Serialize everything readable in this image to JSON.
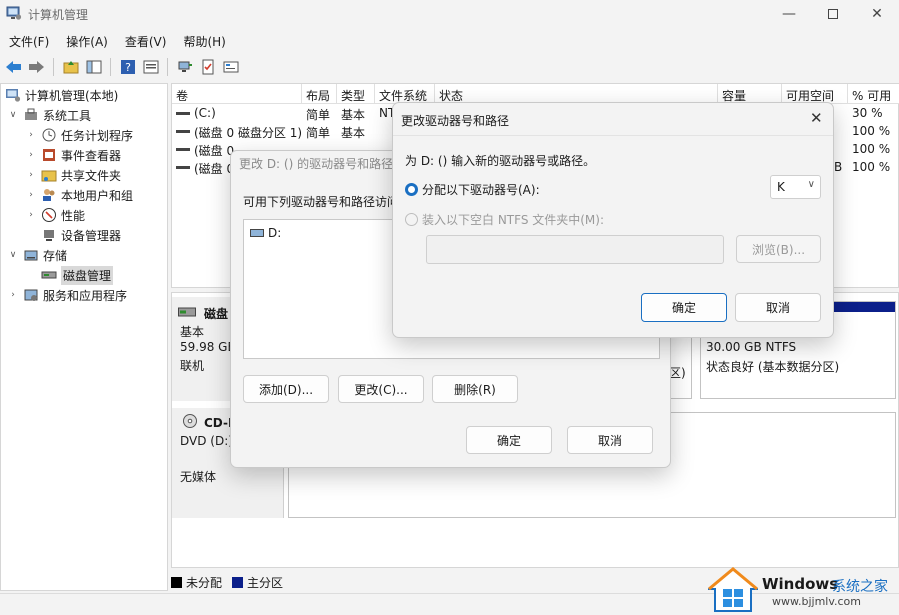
{
  "window": {
    "title": "计算机管理"
  },
  "menu": [
    "文件(F)",
    "操作(A)",
    "查看(V)",
    "帮助(H)"
  ],
  "toolbar": [
    "back-icon",
    "forward-icon",
    "up-folder-icon",
    "show-hide-tree-icon",
    "help-icon",
    "properties-icon",
    "connect-icon",
    "checklist-icon",
    "console-icon"
  ],
  "tree": {
    "root": "计算机管理(本地)",
    "system_tools": "系统工具",
    "task_scheduler": "任务计划程序",
    "event_viewer": "事件查看器",
    "shared_folders": "共享文件夹",
    "local_users": "本地用户和组",
    "performance": "性能",
    "device_manager": "设备管理器",
    "storage": "存储",
    "disk_management": "磁盘管理",
    "services": "服务和应用程序"
  },
  "list": {
    "headers": [
      "卷",
      "布局",
      "类型",
      "文件系统",
      "状态",
      "容量",
      "可用空间",
      "% 可用"
    ],
    "rows": [
      {
        "volume": "(C:)",
        "layout": "简单",
        "type": "基本",
        "fs": "NT",
        "free": "",
        "pct": "30 %"
      },
      {
        "volume": "(磁盘 0 磁盘分区 1)",
        "layout": "简单",
        "type": "基本",
        "fs": "",
        "free": "",
        "pct": "100 %"
      },
      {
        "volume": "(磁盘 0",
        "layout": "",
        "type": "",
        "fs": "",
        "free": "",
        "pct": "100 %"
      },
      {
        "volume": "(磁盘 0",
        "layout": "",
        "type": "",
        "fs": "",
        "free": "B",
        "pct": "100 %"
      }
    ]
  },
  "disk0": {
    "name": "磁盘",
    "type": "基本",
    "size": "59.98 GB",
    "status": "联机"
  },
  "disk0_part": {
    "size": "30.00 GB NTFS",
    "status": "状态良好 (基本数据分区)",
    "prev_tail": "区)"
  },
  "cdrom": {
    "name": "CD-I",
    "drive": "DVD (D:)",
    "media": "无媒体"
  },
  "legend": {
    "unallocated": "未分配",
    "primary": "主分区",
    "unallocated_color": "#000000",
    "primary_color": "#0b1f8a"
  },
  "dialog_paths": {
    "title": "更改 D: () 的驱动器号和路径",
    "desc": "可用下列驱动器号和路径访问",
    "item": "D:",
    "add": "添加(D)...",
    "change": "更改(C)...",
    "remove": "删除(R)",
    "ok": "确定",
    "cancel": "取消"
  },
  "dialog_change": {
    "title": "更改驱动器号和路径",
    "prompt": "为 D: () 输入新的驱动器号或路径。",
    "assign": "分配以下驱动器号(A):",
    "letter": "K",
    "mount": "装入以下空白 NTFS 文件夹中(M):",
    "browse": "浏览(B)...",
    "ok": "确定",
    "cancel": "取消"
  },
  "watermark": {
    "brand": "Windows",
    "site_name": "系统之家",
    "url": "www.bjjmlv.com"
  },
  "accent": "#1a6fc2"
}
